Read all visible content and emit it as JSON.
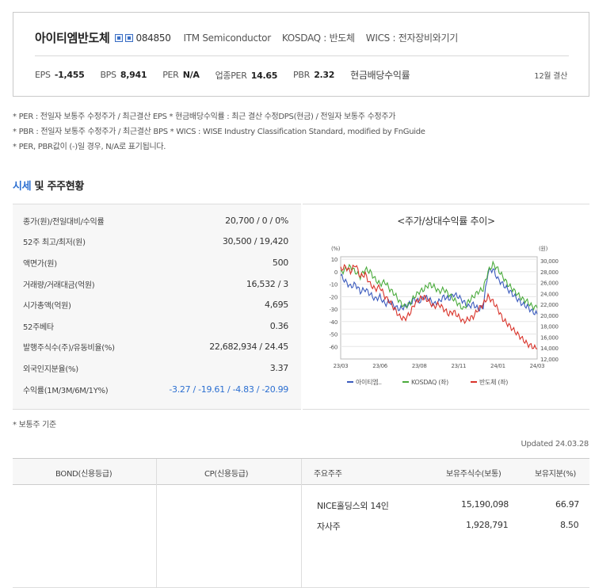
{
  "header": {
    "company": "아이티엠반도체",
    "code": "084850",
    "english_name": "ITM Semiconductor",
    "market": "KOSDAQ : 반도체",
    "wics": "WICS : 전자장비와기기",
    "metrics": [
      {
        "label": "EPS",
        "value": "-1,455"
      },
      {
        "label": "BPS",
        "value": "8,941"
      },
      {
        "label": "PER",
        "value": "N/A"
      },
      {
        "label": "업종PER",
        "value": "14.65"
      },
      {
        "label": "PBR",
        "value": "2.32"
      }
    ],
    "dividend_label": "현금배당수익률",
    "settlement": "12월 결산"
  },
  "notes": [
    "* PER : 전일자 보통주 수정주가 / 최근결산 EPS * 현금배당수익률 : 최근 결산 수정DPS(현금) / 전일자 보통주 수정주가",
    "* PBR : 전일자 보통주 수정주가 / 최근결산 BPS * WICS : WISE Industry Classification Standard, modified by FnGuide",
    "* PER, PBR값이 (-)일 경우, N/A로 표기됩니다."
  ],
  "section": {
    "title_accent": "시세",
    "title_rest": " 및 주주현황"
  },
  "market_rows": [
    {
      "label": "종가(원)/전일대비/수익률",
      "value": "20,700 / 0 / 0%"
    },
    {
      "label": "52주 최고/최저(원)",
      "value": "30,500 / 19,420"
    },
    {
      "label": "액면가(원)",
      "value": "500"
    },
    {
      "label": "거래량/거래대금(억원)",
      "value": "16,532 / 3"
    },
    {
      "label": "시가총액(억원)",
      "value": "4,695"
    },
    {
      "label": "52주베타",
      "value": "0.36"
    },
    {
      "label": "발행주식수(주)/유동비율(%)",
      "value": "22,682,934 / 24.45"
    },
    {
      "label": "외국인지분율(%)",
      "value": "3.37"
    },
    {
      "label": "수익률(1M/3M/6M/1Y%)",
      "value": "-3.27 / -19.61 / -4.83 / -20.99"
    }
  ],
  "chart_data": {
    "type": "line",
    "title": "<주가/상대수익률 추이>",
    "left_unit": "(%)",
    "right_unit": "(원)",
    "x_ticks": [
      "23/03",
      "23/06",
      "23/08",
      "23/11",
      "24/01",
      "24/03"
    ],
    "left_ticks": [
      10,
      0,
      -10,
      -20,
      -30,
      -40,
      -50,
      -60
    ],
    "right_ticks": [
      "30,000",
      "28,000",
      "26,000",
      "24,000",
      "22,000",
      "20,000",
      "18,000",
      "16,000",
      "14,000",
      "12,000"
    ],
    "ylim_left": [
      -70,
      12
    ],
    "ylim_right": [
      12000,
      30500
    ],
    "series": [
      {
        "name": "아이티엠..",
        "color": "#3b5bbd",
        "axis": "left",
        "values": [
          -3,
          -8,
          -12,
          -10,
          -16,
          -14,
          -18,
          -22,
          -20,
          -26,
          -24,
          -28,
          -30,
          -28,
          -26,
          -22,
          -24,
          -20,
          -22,
          -26,
          -24,
          -20,
          -22,
          -18,
          -20,
          -24,
          -28,
          -26,
          -30,
          -28,
          0,
          2,
          -6,
          -10,
          -14,
          -18,
          -22,
          -26,
          -28,
          -32,
          -34
        ]
      },
      {
        "name": "KOSDAQ (좌)",
        "color": "#4aab3c",
        "axis": "left",
        "values": [
          -1,
          2,
          4,
          0,
          -4,
          2,
          0,
          -6,
          -10,
          -8,
          -14,
          -18,
          -24,
          -28,
          -26,
          -20,
          -16,
          -14,
          -10,
          -12,
          -16,
          -14,
          -18,
          -22,
          -26,
          -30,
          -24,
          -20,
          -16,
          -14,
          0,
          6,
          2,
          -4,
          -10,
          -14,
          -18,
          -22,
          -24,
          -28,
          -29
        ]
      },
      {
        "name": "반도체 (좌)",
        "color": "#d9342b",
        "axis": "left",
        "values": [
          2,
          4,
          0,
          6,
          -4,
          -2,
          -10,
          -14,
          -12,
          -20,
          -24,
          -30,
          -36,
          -38,
          -34,
          -26,
          -22,
          -20,
          -24,
          -28,
          -26,
          -30,
          -34,
          -32,
          -36,
          -40,
          -38,
          -36,
          -30,
          -26,
          -20,
          -24,
          -30,
          -38,
          -42,
          -46,
          -50,
          -54,
          -58,
          -60,
          -62
        ]
      }
    ]
  },
  "basis_note": "* 보통주 기준",
  "updated": "Updated 24.03.28",
  "bond_table": {
    "headers": {
      "bond": "BOND(신용등급)",
      "cp": "CP(신용등급)",
      "holder": "주요주주",
      "shares": "보유주식수(보통)",
      "stake": "보유지분(%)"
    },
    "rows": [
      {
        "holder": "NICE홀딩스외 14인",
        "shares": "15,190,098",
        "stake": "66.97"
      },
      {
        "holder": "자사주",
        "shares": "1,928,791",
        "stake": "8.50"
      }
    ]
  }
}
